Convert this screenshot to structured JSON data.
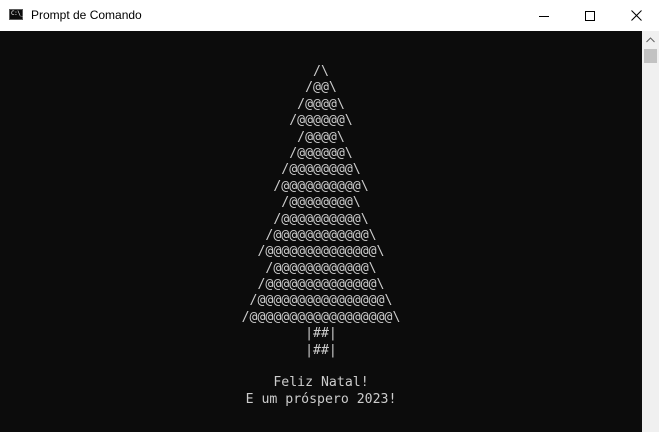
{
  "window": {
    "title": "Prompt de Comando",
    "icon": "console-icon",
    "icon_glyph": "C:\\_",
    "controls": [
      "minimize-icon",
      "maximize-icon",
      "close-icon"
    ]
  },
  "console": {
    "text_color": "#cccccc",
    "background_color": "#0c0c0c",
    "tree_lines": [
      "/\\",
      "/@@\\",
      "/@@@@\\",
      "/@@@@@@\\",
      "/@@@@\\",
      "/@@@@@@\\",
      "/@@@@@@@@\\",
      "/@@@@@@@@@@\\",
      "/@@@@@@@@\\",
      "/@@@@@@@@@@\\",
      "/@@@@@@@@@@@@\\",
      "/@@@@@@@@@@@@@@\\",
      "/@@@@@@@@@@@@\\",
      "/@@@@@@@@@@@@@@\\",
      "/@@@@@@@@@@@@@@@@\\",
      "/@@@@@@@@@@@@@@@@@@\\",
      "|##|",
      "|##|"
    ],
    "greeting_line_1": "Feliz Natal!",
    "greeting_line_2": "E um próspero 2023!"
  },
  "scrollbar": {
    "up_arrow": "scroll-up-arrow-icon"
  }
}
